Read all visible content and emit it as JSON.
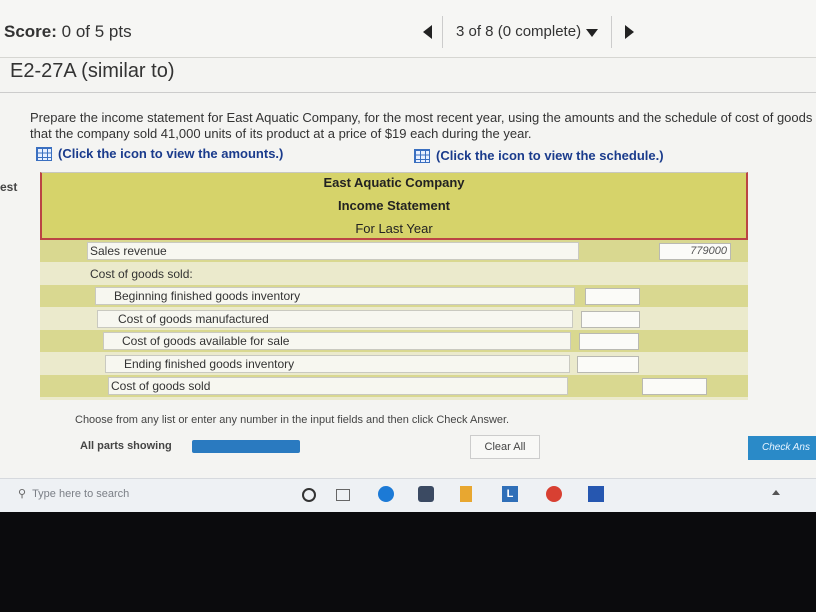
{
  "header": {
    "score_label": "Score:",
    "score_value": "0 of 5 pts",
    "progress": "3 of 8 (0 complete)"
  },
  "question": {
    "title": "E2-27A (similar to)",
    "prompt_line1": "Prepare the income statement for East Aquatic Company, for the most recent year, using the amounts and the schedule of cost of goods",
    "prompt_line2": "that the company sold 41,000 units of its product at a price of $19 each during the year.",
    "link_amounts": "(Click the icon to view the amounts.)",
    "link_schedule": "(Click the icon to view the schedule.)"
  },
  "side_label": "est",
  "statement": {
    "company": "East Aquatic Company",
    "title": "Income Statement",
    "period": "For Last Year",
    "rows": [
      {
        "label": "Sales revenue",
        "value": "779000"
      },
      {
        "label": "Cost of goods sold:",
        "value": ""
      },
      {
        "label": "Beginning finished goods inventory",
        "value": ""
      },
      {
        "label": "Cost of goods manufactured",
        "value": ""
      },
      {
        "label": "Cost of goods available for sale",
        "value": ""
      },
      {
        "label": "Ending finished goods inventory",
        "value": ""
      },
      {
        "label": "Cost of goods sold",
        "value": ""
      }
    ]
  },
  "footer": {
    "instructions": "Choose from any list or enter any number in the input fields and then click Check Answer.",
    "all_parts": "All parts showing",
    "clear_all": "Clear All",
    "check_answer": "Check Ans"
  },
  "taskbar": {
    "search_placeholder": "Type here to search"
  }
}
